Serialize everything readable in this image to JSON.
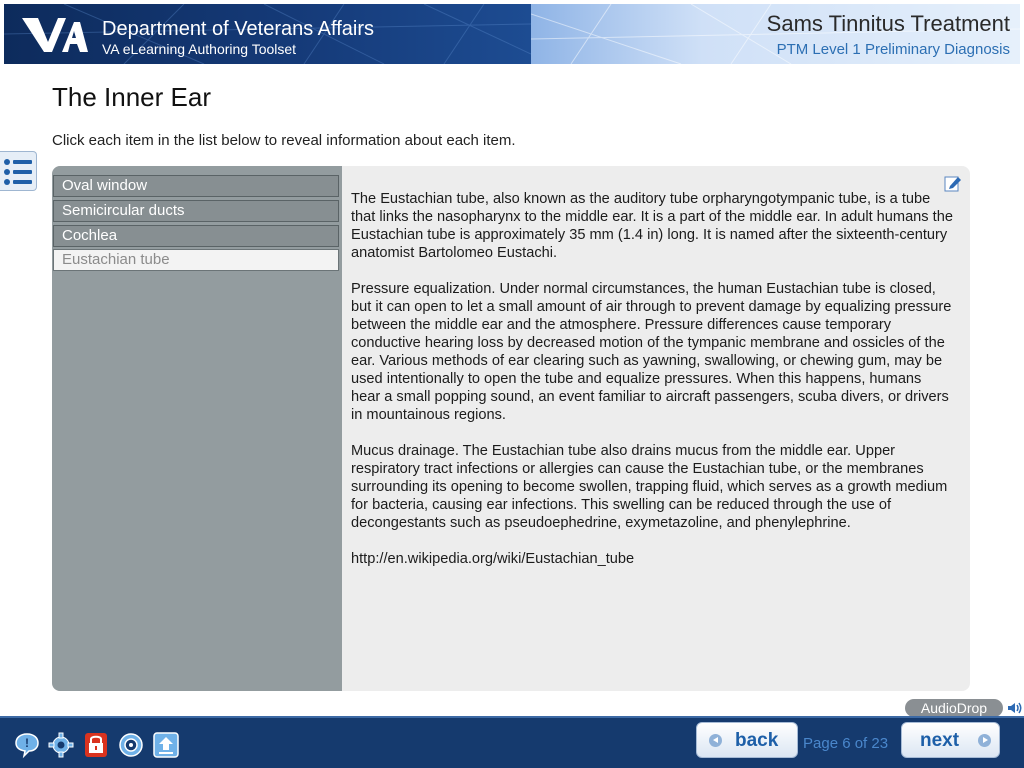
{
  "header": {
    "department": "Department of Veterans Affairs",
    "toolset": "VA eLearning Authoring Toolset",
    "course_title": "Sams Tinnitus Treatment",
    "course_subtitle": "PTM Level 1 Preliminary Diagnosis"
  },
  "page": {
    "title": "The Inner Ear",
    "instructions": "Click each item in the list below to reveal information about each item."
  },
  "list": {
    "items": [
      {
        "label": "Oval window",
        "selected": false
      },
      {
        "label": "Semicircular ducts",
        "selected": false
      },
      {
        "label": "Cochlea",
        "selected": false
      },
      {
        "label": "Eustachian tube",
        "selected": true
      }
    ]
  },
  "content": {
    "paragraphs": [
      "The Eustachian tube, also known as the auditory tube orpharyngotympanic tube, is a tube that links the nasopharynx to the middle ear. It is a part of the middle ear. In adult humans the Eustachian tube is approximately 35 mm (1.4 in) long. It is named after the sixteenth-century anatomist Bartolomeo Eustachi.",
      "Pressure equalization. Under normal circumstances, the human Eustachian tube is closed, but it can open to let a small amount of air through to prevent damage by equalizing pressure between the middle ear and the atmosphere. Pressure differences cause temporary conductive hearing loss  by decreased motion of the tympanic membrane and ossicles of the ear. Various methods of ear clearing such as yawning, swallowing, or chewing gum, may be used intentionally to open the tube and equalize pressures. When this happens, humans hear a small popping sound, an event familiar to aircraft passengers, scuba divers, or drivers in mountainous regions.",
      "Mucus drainage. The Eustachian tube also drains mucus from the middle ear. Upper respiratory tract infections or allergies can cause the Eustachian tube, or the membranes surrounding its opening to become swollen, trapping fluid, which serves as a growth medium for bacteria, causing ear infections. This swelling can be reduced through the use of decongestants such as pseudoephedrine, exymetazoline, and phenylephrine.",
      "http://en.wikipedia.org/wiki/Eustachian_tube"
    ]
  },
  "audio": {
    "label": "AudioDrop"
  },
  "footer": {
    "tools": [
      "help-icon",
      "settings-gear-icon",
      "lock-icon",
      "target-icon",
      "upload-icon"
    ],
    "back_label": "back",
    "next_label": "next",
    "page_indicator": "Page 6 of 23"
  },
  "colors": {
    "header_dark": "#153a78",
    "footer": "#153a6e",
    "list_bg": "#939c9f",
    "content_bg": "#ededed",
    "accent": "#1d5fa8"
  }
}
